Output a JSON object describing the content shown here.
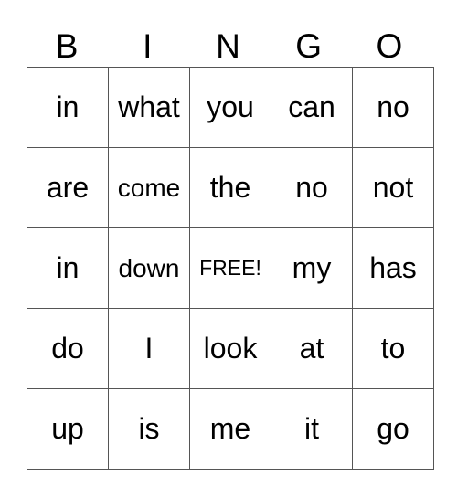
{
  "header": [
    "B",
    "I",
    "N",
    "G",
    "O"
  ],
  "rows": [
    [
      "in",
      "what",
      "you",
      "can",
      "no"
    ],
    [
      "are",
      "come",
      "the",
      "no",
      "not"
    ],
    [
      "in",
      "down",
      "FREE!",
      "my",
      "has"
    ],
    [
      "do",
      "I",
      "look",
      "at",
      "to"
    ],
    [
      "up",
      "is",
      "me",
      "it",
      "go"
    ]
  ]
}
